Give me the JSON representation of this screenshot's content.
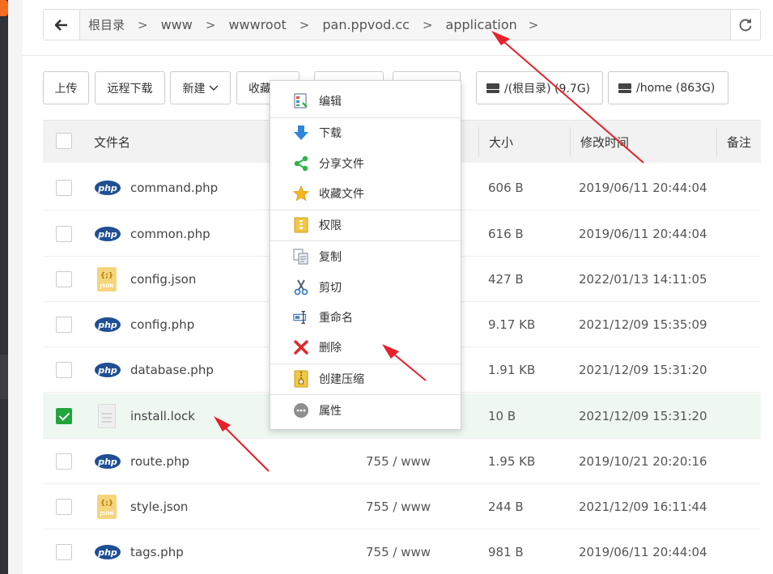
{
  "breadcrumb": {
    "items": [
      "根目录",
      "www",
      "wwwroot",
      "pan.ppvod.cc",
      "application"
    ]
  },
  "toolbar": {
    "upload": "上传",
    "remote_download": "远程下载",
    "new": "新建",
    "favorites": "收藏",
    "disks": [
      "/(根目录) (9.7G)",
      "/home (863G)"
    ]
  },
  "table": {
    "headers": {
      "name": "文件名",
      "size": "大小",
      "modified": "修改时间",
      "note": "备注"
    },
    "rows": [
      {
        "name": "command.php",
        "type": "php",
        "perm": "",
        "size": "606 B",
        "modified": "2019/06/11 20:44:04",
        "selected": false
      },
      {
        "name": "common.php",
        "type": "php",
        "perm": "",
        "size": "616 B",
        "modified": "2019/06/11 20:44:04",
        "selected": false
      },
      {
        "name": "config.json",
        "type": "json",
        "perm": "",
        "size": "427 B",
        "modified": "2022/01/13 14:11:05",
        "selected": false
      },
      {
        "name": "config.php",
        "type": "php",
        "perm": "",
        "size": "9.17 KB",
        "modified": "2021/12/09 15:35:09",
        "selected": false
      },
      {
        "name": "database.php",
        "type": "php",
        "perm": "",
        "size": "1.91 KB",
        "modified": "2021/12/09 15:31:20",
        "selected": false
      },
      {
        "name": "install.lock",
        "type": "file",
        "perm": "",
        "size": "10 B",
        "modified": "2021/12/09 15:31:20",
        "selected": true
      },
      {
        "name": "route.php",
        "type": "php",
        "perm": "755 / www",
        "size": "1.95 KB",
        "modified": "2019/10/21 20:20:16",
        "selected": false
      },
      {
        "name": "style.json",
        "type": "json",
        "perm": "755 / www",
        "size": "244 B",
        "modified": "2021/12/09 16:11:44",
        "selected": false
      },
      {
        "name": "tags.php",
        "type": "php",
        "perm": "755 / www",
        "size": "981 B",
        "modified": "2019/06/11 20:44:04",
        "selected": false
      }
    ]
  },
  "context_menu": {
    "items": [
      {
        "label": "编辑",
        "icon": "edit-icon"
      },
      {
        "label": "下载",
        "icon": "download-icon"
      },
      {
        "label": "分享文件",
        "icon": "share-icon"
      },
      {
        "label": "收藏文件",
        "icon": "star-icon"
      },
      {
        "label": "权限",
        "icon": "permission-icon"
      },
      {
        "label": "复制",
        "icon": "copy-icon"
      },
      {
        "label": "剪切",
        "icon": "scissors-icon"
      },
      {
        "label": "重命名",
        "icon": "rename-icon"
      },
      {
        "label": "删除",
        "icon": "delete-icon"
      },
      {
        "label": "创建压缩",
        "icon": "zip-icon"
      },
      {
        "label": "属性",
        "icon": "properties-icon"
      }
    ]
  },
  "icons": {
    "php_badge": "php",
    "json_badge_top": "{;}",
    "json_badge_bottom": "JSON"
  },
  "colors": {
    "checked": "#20a53a",
    "annotation_arrow": "#e8202a",
    "php_icon": "#1f4f95"
  }
}
